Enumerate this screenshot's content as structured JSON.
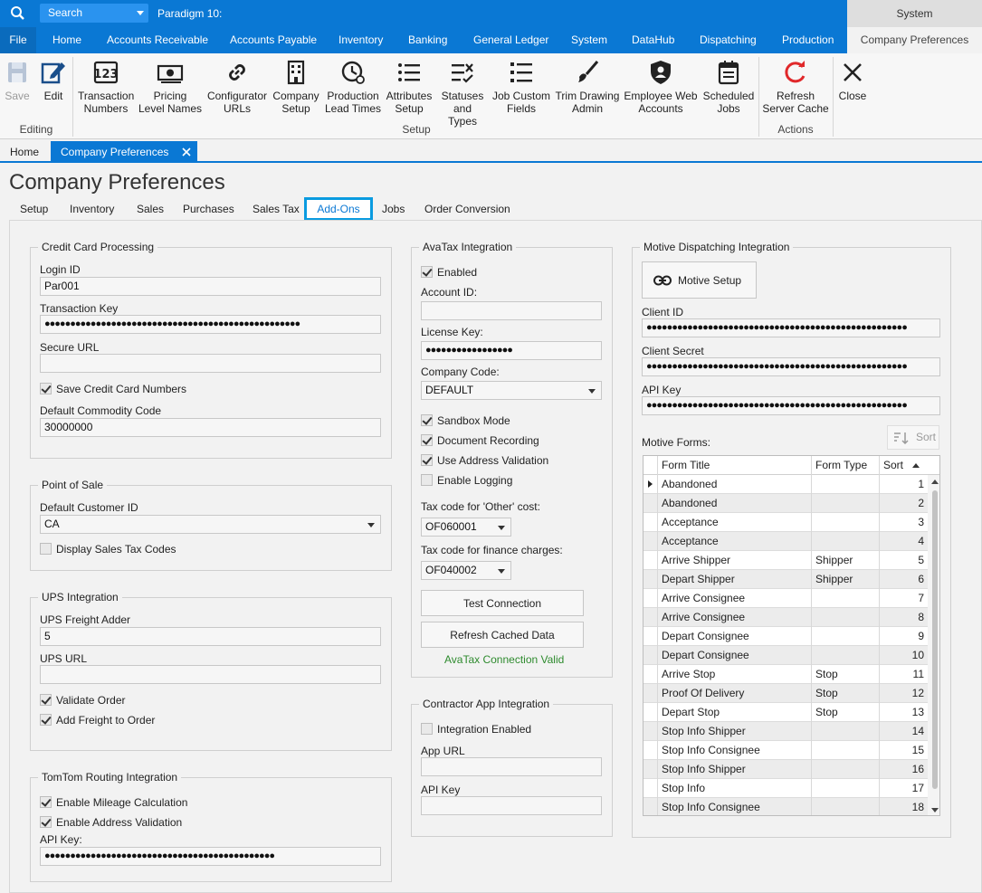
{
  "titlebar": {
    "search_label": "Search",
    "app_title": "Paradigm 10:",
    "system_label": "System"
  },
  "menu": {
    "file": "File",
    "items": [
      "Home",
      "Accounts Receivable",
      "Accounts Payable",
      "Inventory",
      "Banking",
      "General Ledger",
      "System",
      "DataHub",
      "Dispatching",
      "Production",
      "Company Preferences"
    ]
  },
  "ribbon": {
    "save": "Save",
    "edit": "Edit",
    "editing_group": "Editing",
    "transaction_numbers": [
      "Transaction",
      "Numbers"
    ],
    "pricing_level_names": [
      "Pricing",
      "Level Names"
    ],
    "configurator_urls": [
      "Configurator",
      "URLs"
    ],
    "company_setup": [
      "Company",
      "Setup"
    ],
    "production_lead_times": [
      "Production",
      "Lead Times"
    ],
    "attributes_setup": [
      "Attributes",
      "Setup"
    ],
    "statuses_and_types": [
      "Statuses",
      "and Types"
    ],
    "job_custom_fields": [
      "Job Custom",
      "Fields"
    ],
    "trim_drawing_admin": [
      "Trim Drawing",
      "Admin"
    ],
    "employee_web_accounts": [
      "Employee Web",
      "Accounts"
    ],
    "scheduled_jobs": [
      "Scheduled",
      "Jobs"
    ],
    "setup_group": "Setup",
    "refresh_server_cache": [
      "Refresh",
      "Server Cache"
    ],
    "actions_group": "Actions",
    "close": "Close"
  },
  "doc_tabs": {
    "home": "Home",
    "company_preferences": "Company Preferences"
  },
  "page_title": "Company Preferences",
  "sub_tabs": [
    "Setup",
    "Inventory",
    "Sales",
    "Purchases",
    "Sales Tax",
    "Add-Ons",
    "Jobs",
    "Order Conversion"
  ],
  "credit_card": {
    "title": "Credit Card Processing",
    "login_label": "Login ID",
    "login_value": "Par001",
    "tkey_label": "Transaction Key",
    "tkey_value": "●●●●●●●●●●●●●●●●●●●●●●●●●●●●●●●●●●●●●●●●●●●●●●●●●●",
    "url_label": "Secure URL",
    "url_value": "",
    "save_cc": "Save Credit Card Numbers",
    "commodity_label": "Default Commodity Code",
    "commodity_value": "30000000"
  },
  "pos": {
    "title": "Point of Sale",
    "cust_label": "Default Customer ID",
    "cust_value": "CA",
    "display_tax": "Display Sales Tax Codes"
  },
  "ups": {
    "title": "UPS Integration",
    "adder_label": "UPS Freight Adder",
    "adder_value": "5",
    "url_label": "UPS URL",
    "url_value": "",
    "validate": "Validate Order",
    "add_freight": "Add Freight to Order"
  },
  "tomtom": {
    "title": "TomTom Routing Integration",
    "mileage": "Enable Mileage Calculation",
    "addr": "Enable Address Validation",
    "key_label": "API Key:",
    "key_value": "●●●●●●●●●●●●●●●●●●●●●●●●●●●●●●●●●●●●●●●●●●●●●"
  },
  "avatax": {
    "title": "AvaTax Integration",
    "enabled": "Enabled",
    "account_label": "Account ID:",
    "account_value": "",
    "license_label": "License Key:",
    "license_value": "●●●●●●●●●●●●●●●●●",
    "company_label": "Company Code:",
    "company_value": "DEFAULT",
    "sandbox": "Sandbox Mode",
    "doc_rec": "Document Recording",
    "use_addr": "Use Address Validation",
    "logging": "Enable Logging",
    "other_label": "Tax code for 'Other' cost:",
    "other_value": "OF060001",
    "finance_label": "Tax code for finance charges:",
    "finance_value": "OF040002",
    "test_btn": "Test Connection",
    "refresh_btn": "Refresh Cached Data",
    "status": "AvaTax Connection Valid"
  },
  "contractor": {
    "title": "Contractor App Integration",
    "enabled": "Integration Enabled",
    "url_label": "App URL",
    "url_value": "",
    "key_label": "API Key",
    "key_value": ""
  },
  "motive": {
    "title": "Motive Dispatching Integration",
    "setup_btn": "Motive Setup",
    "client_id_label": "Client ID",
    "client_id_value": "●●●●●●●●●●●●●●●●●●●●●●●●●●●●●●●●●●●●●●●●●●●●●●●●●●●",
    "secret_label": "Client Secret",
    "secret_value": "●●●●●●●●●●●●●●●●●●●●●●●●●●●●●●●●●●●●●●●●●●●●●●●●●●●",
    "api_label": "API Key",
    "api_value": "●●●●●●●●●●●●●●●●●●●●●●●●●●●●●●●●●●●●●●●●●●●●●●●●●●●",
    "sort_btn": "Sort",
    "forms_label": "Motive Forms:",
    "columns": [
      "Form Title",
      "Form Type",
      "Sort"
    ],
    "rows": [
      [
        "Abandoned",
        "",
        "1"
      ],
      [
        "Abandoned",
        "",
        "2"
      ],
      [
        "Acceptance",
        "",
        "3"
      ],
      [
        "Acceptance",
        "",
        "4"
      ],
      [
        "Arrive Shipper",
        "Shipper",
        "5"
      ],
      [
        "Depart Shipper",
        "Shipper",
        "6"
      ],
      [
        "Arrive Consignee",
        "",
        "7"
      ],
      [
        "Arrive Consignee",
        "",
        "8"
      ],
      [
        "Depart Consignee",
        "",
        "9"
      ],
      [
        "Depart Consignee",
        "",
        "10"
      ],
      [
        "Arrive Stop",
        "Stop",
        "11"
      ],
      [
        "Proof Of Delivery",
        "Stop",
        "12"
      ],
      [
        "Depart Stop",
        "Stop",
        "13"
      ],
      [
        "Stop Info Shipper",
        "",
        "14"
      ],
      [
        "Stop Info Consignee",
        "",
        "15"
      ],
      [
        "Stop Info Shipper",
        "",
        "16"
      ],
      [
        "Stop Info",
        "",
        "17"
      ],
      [
        "Stop Info Consignee",
        "",
        "18"
      ]
    ]
  }
}
